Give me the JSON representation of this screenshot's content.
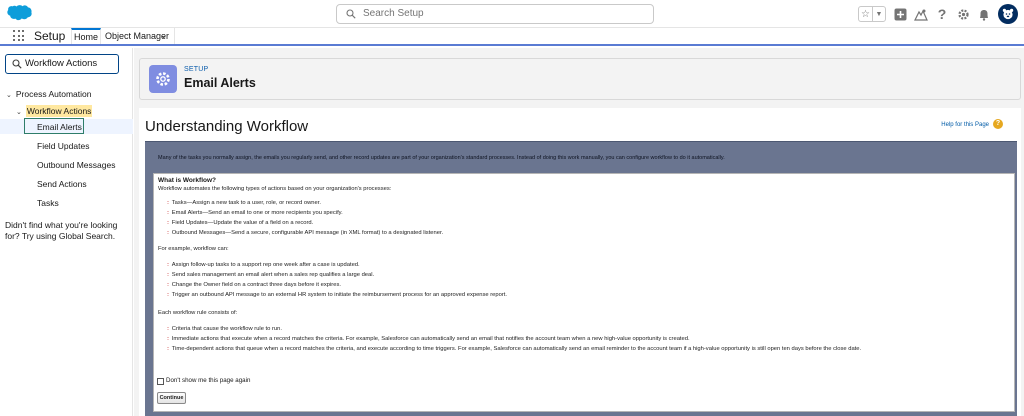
{
  "header": {
    "search_placeholder": "Search Setup",
    "icons": [
      "cloud-logo",
      "favorites-star-icon",
      "favorites-dropdown-icon",
      "global-actions-plus-icon",
      "trailhead-icon",
      "help-icon",
      "setup-gear-icon",
      "notifications-bell-icon",
      "user-avatar"
    ],
    "help_glyph": "?"
  },
  "app_nav": {
    "app_name": "Setup",
    "tabs": [
      {
        "label": "Home",
        "active": true
      },
      {
        "label": "Object Manager",
        "has_dropdown": true
      }
    ]
  },
  "sidebar": {
    "quick_find_value": "Workflow Actions",
    "tree": {
      "section": "Process Automation",
      "group": "Workflow Actions",
      "items": [
        "Email Alerts",
        "Field Updates",
        "Outbound Messages",
        "Send Actions",
        "Tasks"
      ],
      "selected": "Email Alerts"
    },
    "help_text": "Didn't find what you're looking for? Try using Global Search."
  },
  "page_header": {
    "eyebrow": "SETUP",
    "title": "Email Alerts"
  },
  "content": {
    "title": "Understanding Workflow",
    "help_link": "Help for this Page",
    "help_glyph": "?",
    "intro": "Many of the tasks you normally assign, the emails you regularly send, and other record updates are part of your organization's standard processes. Instead of doing this work manually, you can configure workflow to do it automatically.",
    "what_is_heading": "What is Workflow?",
    "what_is_text": "Workflow automates the following types of actions based on your organization's processes:",
    "action_types": [
      "Tasks—Assign a new task to a user, role, or record owner.",
      "Email Alerts—Send an email to one or more recipients you specify.",
      "Field Updates—Update the value of a field on a record.",
      "Outbound Messages—Send a secure, configurable API message (in XML format) to a designated listener."
    ],
    "example_intro": "For example, workflow can:",
    "examples": [
      "Assign follow-up tasks to a support rep one week after a case is updated.",
      "Send sales management an email alert when a sales rep qualifies a large deal.",
      "Change the Owner field on a contract three days before it expires.",
      "Trigger an outbound API message to an external HR system to initiate the reimbursement process for an approved expense report."
    ],
    "rule_intro": "Each workflow rule consists of:",
    "rule_parts": [
      "Criteria that cause the workflow rule to run.",
      "Immediate actions that execute when a record matches the criteria. For example, Salesforce can automatically send an email that notifies the account team when a new high-value opportunity is created.",
      "Time-dependent actions that queue when a record matches the criteria, and execute according to time triggers. For example, Salesforce can automatically send an email reminder to the account team if a high-value opportunity is still open ten days before the close date."
    ],
    "checkbox_label": "Don't show me this page again",
    "continue_label": "Continue"
  },
  "colors": {
    "brand_blue": "#0176d3",
    "frame_slate": "#6a7590",
    "page_header_icon": "#7f8de1",
    "highlight": "#ffe8a0",
    "selected_outline": "#2e7d6a",
    "bullet_red": "#c62828"
  }
}
